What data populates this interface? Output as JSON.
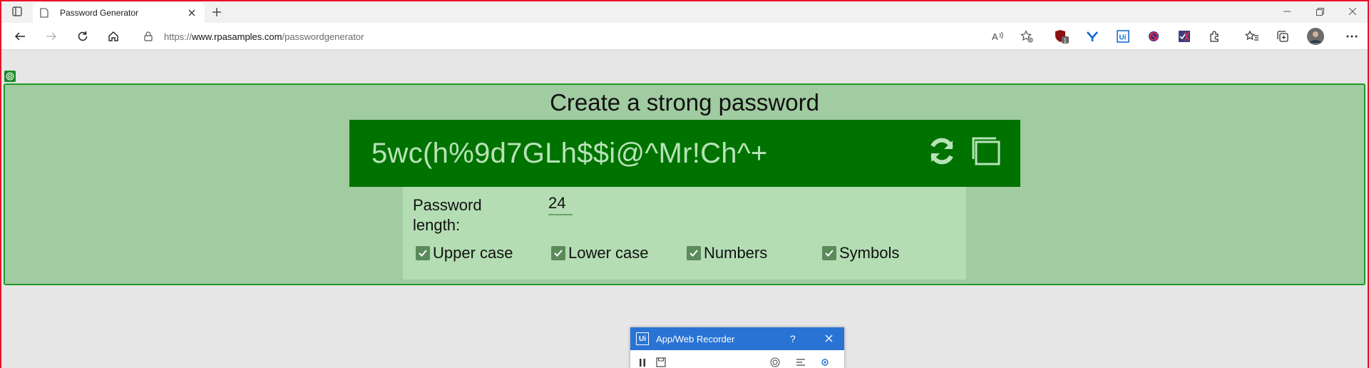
{
  "browser": {
    "tab": {
      "title": "Password Generator"
    },
    "address": {
      "scheme": "https://",
      "host": "www.rpasamples.com",
      "path": "/passwordgenerator"
    },
    "extensions": [
      "ublock-badge-icon",
      "vpn-icon",
      "uipath-extension-icon",
      "blocked-extension-icon",
      "checklist-extension-icon",
      "extensions-puzzle-icon"
    ],
    "ublock_count": "1"
  },
  "page": {
    "headline": "Create a strong password",
    "password": "5wc(h%9d7GLh$$i@^Mr!Ch^+",
    "length_label": "Password length:",
    "length_value": "24",
    "options": [
      {
        "label": "Upper case",
        "checked": true
      },
      {
        "label": "Lower case",
        "checked": true
      },
      {
        "label": "Numbers",
        "checked": true
      },
      {
        "label": "Symbols",
        "checked": true
      }
    ]
  },
  "recorder": {
    "title": "App/Web Recorder",
    "logo": "Ui",
    "help": "?"
  },
  "colors": {
    "accent": "#007200",
    "highlight": "#a1cba1",
    "options_bg": "#b4ddb4",
    "recorder_bar": "#2973d4"
  }
}
